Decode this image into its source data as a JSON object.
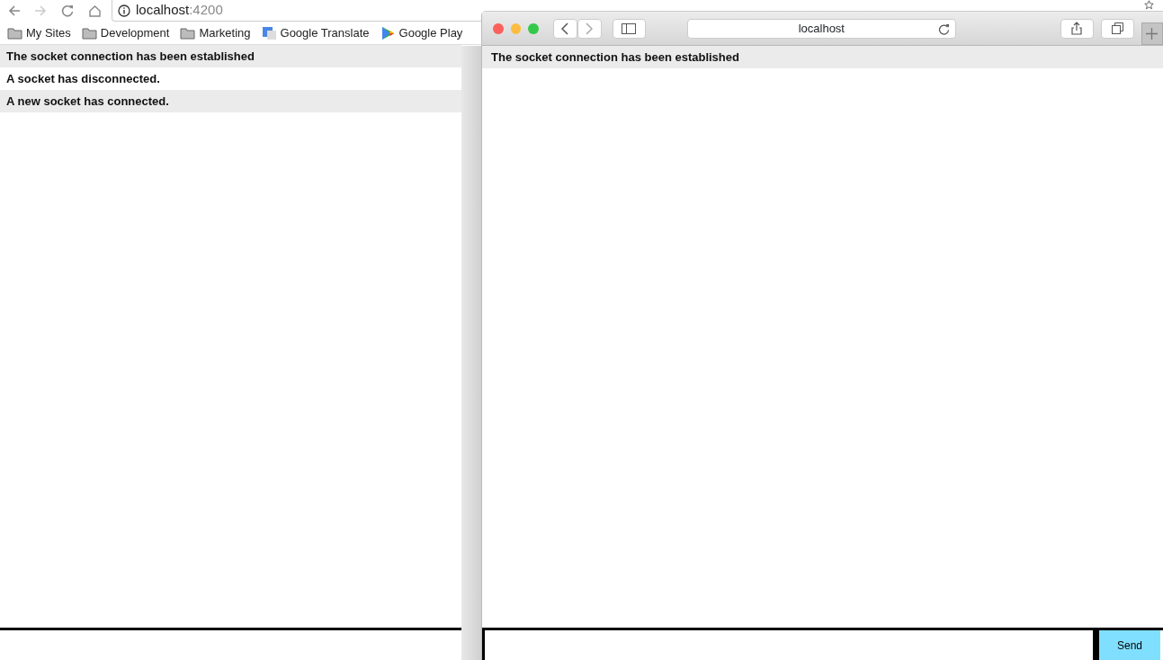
{
  "left_window": {
    "address": {
      "host": "localhost",
      "port": ":4200"
    },
    "bookmarks": [
      {
        "label": "My Sites",
        "kind": "folder"
      },
      {
        "label": "Development",
        "kind": "folder"
      },
      {
        "label": "Marketing",
        "kind": "folder"
      },
      {
        "label": "Google Translate",
        "kind": "translate"
      },
      {
        "label": "Google Play",
        "kind": "play"
      }
    ],
    "messages": [
      "The socket connection has been established",
      "A socket has disconnected.",
      "A new socket has connected."
    ]
  },
  "right_window": {
    "address": "localhost",
    "messages": [
      "The socket connection has been established"
    ],
    "send_button": "Send"
  }
}
